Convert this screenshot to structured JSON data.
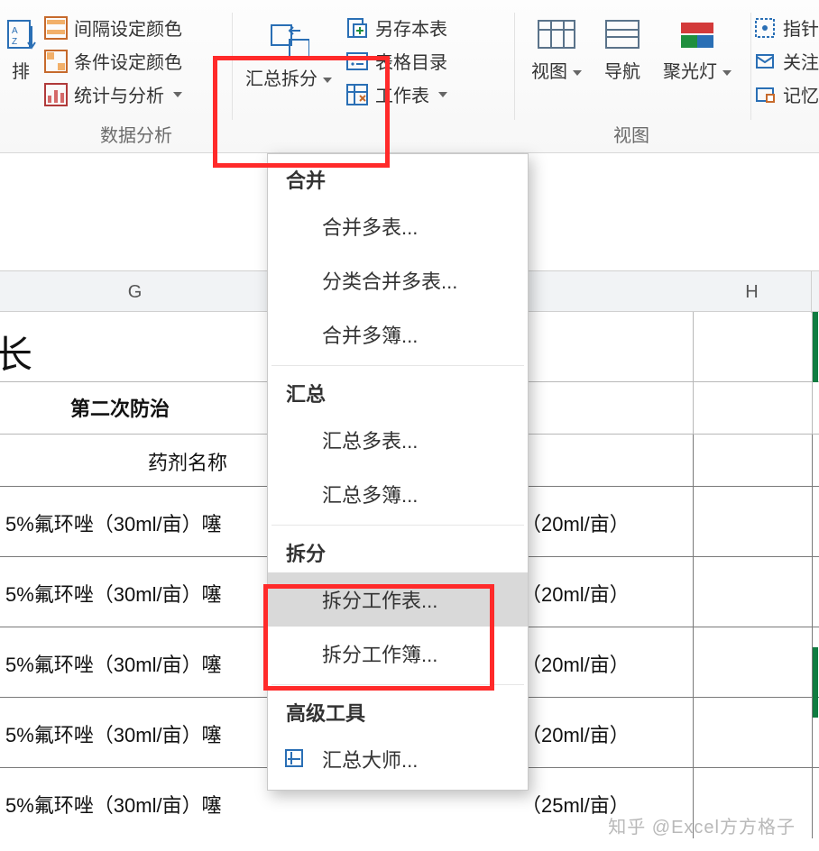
{
  "ribbon": {
    "sort_label": "排",
    "analysis": {
      "interval_color": "间隔设定颜色",
      "condition_color": "条件设定颜色",
      "stats": "统计与分析",
      "section": "数据分析"
    },
    "summary": {
      "label": "汇总拆分"
    },
    "tables": {
      "save_copy": "另存本表",
      "catalog": "表格目录",
      "worksheet": "工作表"
    },
    "view": {
      "view": "视图",
      "nav": "导航",
      "spotlight": "聚光灯",
      "section": "视图"
    },
    "right": {
      "pointer": "指针",
      "follow": "关注",
      "remember": "记忆"
    }
  },
  "menu": {
    "sec_merge": "合并",
    "merge_tables": "合并多表...",
    "merge_category": "分类合并多表...",
    "merge_books": "合并多簿...",
    "sec_sum": "汇总",
    "sum_tables": "汇总多表...",
    "sum_books": "汇总多簿...",
    "sec_split": "拆分",
    "split_sheet": "拆分工作表...",
    "split_book": "拆分工作簿...",
    "sec_adv": "高级工具",
    "master": "汇总大师..."
  },
  "sheet": {
    "colG": "G",
    "colH": "H",
    "title_tail": "长",
    "subheader": "第二次防治",
    "subheader2": "药剂名称",
    "rows": [
      {
        "left": "5%氟环唑（30ml/亩）噻",
        "right": "（20ml/亩）"
      },
      {
        "left": "5%氟环唑（30ml/亩）噻",
        "right": "（20ml/亩）"
      },
      {
        "left": "5%氟环唑（30ml/亩）噻",
        "right": "（20ml/亩）"
      },
      {
        "left": "5%氟环唑（30ml/亩）噻",
        "right": "（20ml/亩）"
      },
      {
        "left": "5%氟环唑（30ml/亩）噻",
        "right": "（25ml/亩）"
      }
    ]
  },
  "watermark": "知乎 @Excel方方格子"
}
